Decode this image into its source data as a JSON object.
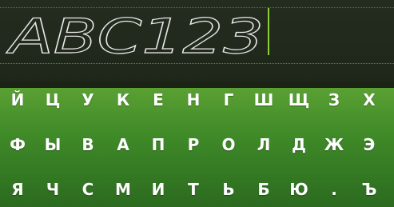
{
  "input": {
    "typed_text": "ABC123"
  },
  "keyboard": {
    "rows": [
      [
        "Й",
        "Ц",
        "У",
        "К",
        "Е",
        "Н",
        "Г",
        "Ш",
        "Щ",
        "З",
        "Х"
      ],
      [
        "Ф",
        "Ы",
        "В",
        "А",
        "П",
        "Р",
        "О",
        "Л",
        "Д",
        "Ж",
        "Э"
      ],
      [
        "Я",
        "Ч",
        "С",
        "М",
        "И",
        "Т",
        "Ь",
        "Б",
        "Ю",
        ".",
        "Ъ"
      ]
    ]
  },
  "colors": {
    "input_background": "#242c20",
    "cursor": "#8bd03a",
    "keyboard_top": "#5aa033",
    "keyboard_bottom": "#2b6a1f",
    "key_text": "#ffffff",
    "handwriting_stroke": "#e8e8e8"
  }
}
